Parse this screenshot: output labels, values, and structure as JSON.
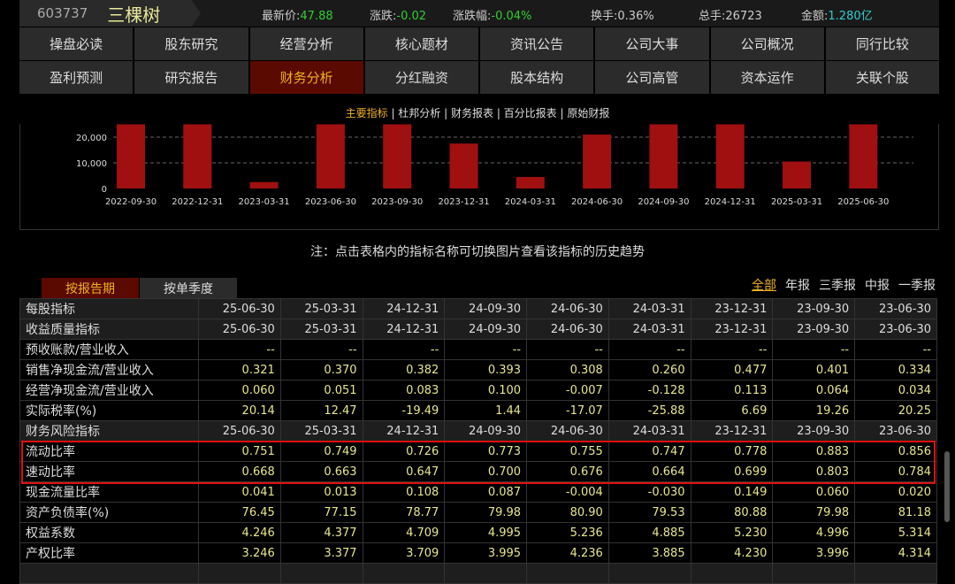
{
  "header": {
    "code": "603737",
    "name": "三棵树",
    "quotes": [
      {
        "label": "最新价:",
        "value": "47.88",
        "cls": "g"
      },
      {
        "label": "涨跌:",
        "value": "-0.02",
        "cls": "g"
      },
      {
        "label": "涨跌幅:",
        "value": "-0.04%",
        "cls": "g"
      },
      {
        "label": "换手:",
        "value": "0.36%",
        "cls": ""
      },
      {
        "label": "总手:",
        "value": "26723",
        "cls": ""
      },
      {
        "label": "金额:",
        "value": "1.280亿",
        "cls": "c"
      }
    ]
  },
  "nav_row1": [
    "操盘必读",
    "股东研究",
    "经营分析",
    "核心题材",
    "资讯公告",
    "公司大事",
    "公司概况",
    "同行比较"
  ],
  "nav_row2": [
    "盈利预测",
    "研究报告",
    "财务分析",
    "分红融资",
    "股本结构",
    "公司高管",
    "资本运作",
    "关联个股"
  ],
  "active_nav": "财务分析",
  "subtabs": [
    "主要指标",
    "杜邦分析",
    "财务报表",
    "百分比报表",
    "原始财报"
  ],
  "active_subtab": "主要指标",
  "chart_data": {
    "type": "bar",
    "categories": [
      "2022-09-30",
      "2022-12-31",
      "2023-03-31",
      "2023-06-30",
      "2023-09-30",
      "2023-12-31",
      "2024-03-31",
      "2024-06-30",
      "2024-09-30",
      "2024-12-31",
      "2025-03-31",
      "2025-06-30"
    ],
    "values": [
      25000,
      25000,
      2500,
      25000,
      25000,
      17500,
      4500,
      21000,
      25000,
      25000,
      10500,
      25000
    ],
    "yticks": [
      "0",
      "10,000",
      "20,000"
    ],
    "color": "#a01010"
  },
  "note": "注：点击表格内的指标名称可切换图片查看该指标的历史趋势",
  "period_tabs": [
    "按报告期",
    "按单季度"
  ],
  "filters": [
    "全部",
    "年报",
    "三季报",
    "中报",
    "一季报"
  ],
  "table": {
    "dates": [
      "25-06-30",
      "25-03-31",
      "24-12-31",
      "24-09-30",
      "24-06-30",
      "24-03-31",
      "23-12-31",
      "23-09-30",
      "23-06-30"
    ],
    "rows": [
      {
        "label": "每股指标",
        "header": true
      },
      {
        "label": "收益质量指标",
        "header": true
      },
      {
        "label": "预收账款/营业收入",
        "values": [
          "--",
          "--",
          "--",
          "--",
          "--",
          "--",
          "--",
          "--",
          "--"
        ]
      },
      {
        "label": "销售净现金流/营业收入",
        "values": [
          "0.321",
          "0.370",
          "0.382",
          "0.393",
          "0.308",
          "0.260",
          "0.477",
          "0.401",
          "0.334"
        ]
      },
      {
        "label": "经营净现金流/营业收入",
        "values": [
          "0.060",
          "0.051",
          "0.083",
          "0.100",
          "-0.007",
          "-0.128",
          "0.113",
          "0.064",
          "0.034"
        ]
      },
      {
        "label": "实际税率(%)",
        "values": [
          "20.14",
          "12.47",
          "-19.49",
          "1.44",
          "-17.07",
          "-25.88",
          "6.69",
          "19.26",
          "20.25"
        ]
      },
      {
        "label": "财务风险指标",
        "header": true
      },
      {
        "label": "流动比率",
        "values": [
          "0.751",
          "0.749",
          "0.726",
          "0.773",
          "0.755",
          "0.747",
          "0.778",
          "0.883",
          "0.856"
        ]
      },
      {
        "label": "速动比率",
        "values": [
          "0.668",
          "0.663",
          "0.647",
          "0.700",
          "0.676",
          "0.664",
          "0.699",
          "0.803",
          "0.784"
        ]
      },
      {
        "label": "现金流量比率",
        "values": [
          "0.041",
          "0.013",
          "0.108",
          "0.087",
          "-0.004",
          "-0.030",
          "0.149",
          "0.060",
          "0.020"
        ]
      },
      {
        "label": "资产负债率(%)",
        "values": [
          "76.45",
          "77.15",
          "78.77",
          "79.98",
          "80.90",
          "79.53",
          "80.88",
          "79.98",
          "81.18"
        ]
      },
      {
        "label": "权益系数",
        "values": [
          "4.246",
          "4.377",
          "4.709",
          "4.995",
          "5.236",
          "4.885",
          "5.230",
          "4.996",
          "5.314"
        ]
      },
      {
        "label": "产权比率",
        "values": [
          "3.246",
          "3.377",
          "3.709",
          "3.995",
          "4.236",
          "3.885",
          "4.230",
          "3.996",
          "4.314"
        ]
      }
    ]
  }
}
